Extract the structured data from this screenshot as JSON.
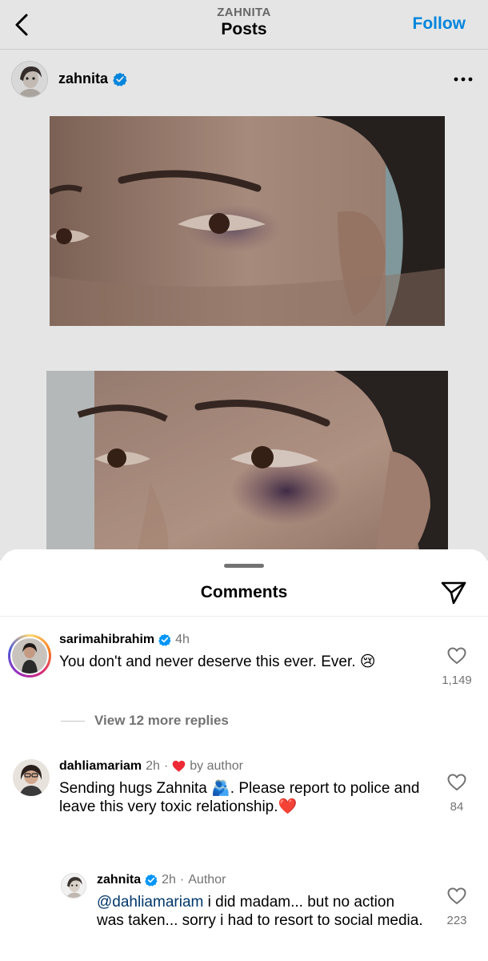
{
  "header": {
    "subtitle": "ZAHNITA",
    "title": "Posts",
    "follow_label": "Follow"
  },
  "post": {
    "author": "zahnita",
    "more_label": "•••"
  },
  "comments_sheet": {
    "title": "Comments",
    "comments": [
      {
        "username": "sarimahibrahim",
        "time": "4h",
        "text": "You don't and never deserve this ever. Ever. 😢",
        "likes": "1,149"
      },
      {
        "username": "dahliamariam",
        "time": "2h",
        "dot": "·",
        "author_like": "by author",
        "text": "Sending hugs Zahnita 🫂. Please report to police and leave this very toxic relationship.❤️",
        "likes": "84"
      }
    ],
    "view_replies": "View 12 more replies",
    "reply": {
      "username": "zahnita",
      "time": "2h",
      "dot": "·",
      "author_tag": "Author",
      "mention": "@dahliamariam",
      "text": " i did madam... but no action was taken... sorry i had to resort to social media.",
      "likes": "223"
    }
  },
  "colors": {
    "accent": "#0095f6",
    "verified": "#0095f6",
    "heart_red": "#ed2a35",
    "mention": "#00376b",
    "muted": "#737373"
  },
  "icons": [
    "chevron-left-icon",
    "verified-badge-icon",
    "more-options-icon",
    "paper-plane-icon",
    "heart-outline-icon",
    "heart-filled-icon"
  ]
}
